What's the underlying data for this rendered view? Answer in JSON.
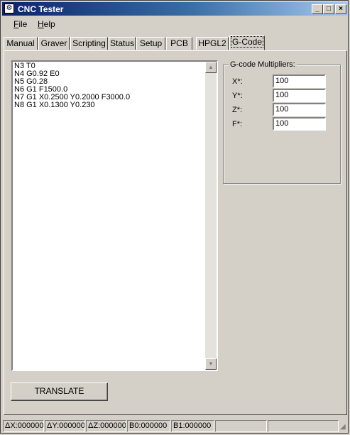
{
  "window": {
    "title": "CNC Tester"
  },
  "titlebar": {
    "minimize": "_",
    "maximize": "□",
    "close": "×"
  },
  "menu": [
    {
      "first": "F",
      "rest": "ile"
    },
    {
      "first": "H",
      "rest": "elp"
    }
  ],
  "tabs": [
    "Manual",
    "Graver",
    "Scripting",
    "Status",
    "Setup",
    "PCB",
    "HPGL2",
    "G-Code"
  ],
  "active_tab": "G-Code",
  "editor": {
    "text": "N3 T0\nN4 G0.92 E0\nN5 G0.28\nN6 G1 F1500.0\nN7 G1 X0.2500 Y0.2000 F3000.0\nN8 G1 X0.1300 Y0.230"
  },
  "multipliers": {
    "title": "G-code Multipliers:",
    "fields": [
      {
        "label": "X*:",
        "value": "100"
      },
      {
        "label": "Y*:",
        "value": "100"
      },
      {
        "label": "Z*:",
        "value": "100"
      },
      {
        "label": "F*:",
        "value": "100"
      }
    ]
  },
  "translate_button": "TRANSLATE",
  "status": [
    "ΔX:000000",
    "ΔY:000000",
    "ΔZ:000000",
    "B0:000000",
    "B1:000000"
  ]
}
